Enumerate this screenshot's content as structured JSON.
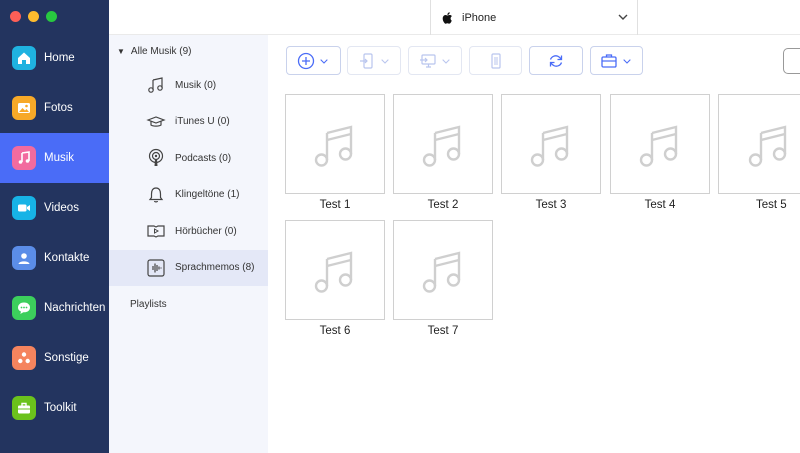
{
  "window": {
    "traffic_colors": [
      "#fe5f57",
      "#febc2e",
      "#28c840"
    ]
  },
  "sidebar": {
    "items": [
      {
        "label": "Home",
        "icon": "home-icon",
        "color": "#1fb2e0"
      },
      {
        "label": "Fotos",
        "icon": "photo-icon",
        "color": "#f7a928"
      },
      {
        "label": "Musik",
        "icon": "music-note-icon",
        "color": "#f26b9f",
        "active": true
      },
      {
        "label": "Videos",
        "icon": "video-camera-icon",
        "color": "#17b3e6"
      },
      {
        "label": "Kontakte",
        "icon": "contact-icon",
        "color": "#5b8de8"
      },
      {
        "label": "Nachrichten",
        "icon": "message-icon",
        "color": "#3ccf5c"
      },
      {
        "label": "Sonstige",
        "icon": "others-icon",
        "color": "#f5845e"
      },
      {
        "label": "Toolkit",
        "icon": "toolbox-icon",
        "color": "#6bc21c"
      }
    ]
  },
  "header": {
    "device_name": "iPhone"
  },
  "library": {
    "root_label": "Alle Musik (9)",
    "items": [
      {
        "label": "Musik (0)",
        "icon": "music-icon"
      },
      {
        "label": "iTunes U (0)",
        "icon": "graduation-cap-icon"
      },
      {
        "label": "Podcasts (0)",
        "icon": "podcast-icon"
      },
      {
        "label": "Klingeltöne (1)",
        "icon": "bell-icon"
      },
      {
        "label": "Hörbücher (0)",
        "icon": "audiobook-icon"
      },
      {
        "label": "Sprachmemos (8)",
        "icon": "voice-memo-icon",
        "selected": true
      }
    ],
    "playlists_label": "Playlists"
  },
  "toolbar": {
    "buttons": [
      "add-button",
      "export-to-device-button",
      "export-to-pc-button",
      "delete-button",
      "refresh-button",
      "toolbox-button"
    ]
  },
  "tracks": [
    {
      "title": "Test 1"
    },
    {
      "title": "Test 2"
    },
    {
      "title": "Test 3"
    },
    {
      "title": "Test 4"
    },
    {
      "title": "Test 5"
    },
    {
      "title": "Test 6"
    },
    {
      "title": "Test 7"
    }
  ]
}
